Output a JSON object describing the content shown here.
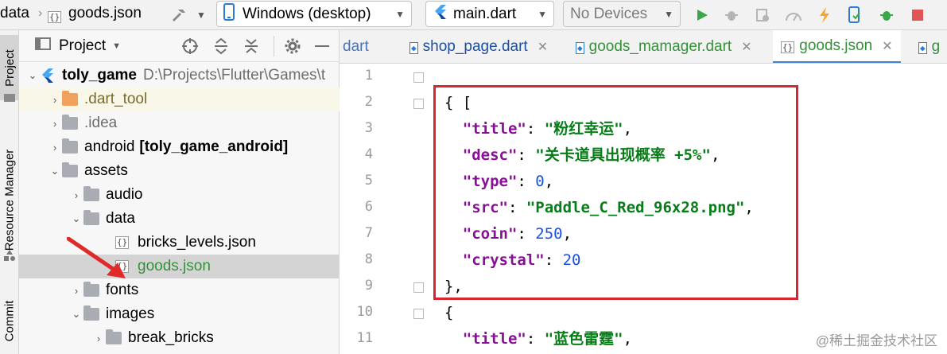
{
  "breadcrumb": [
    "data",
    "goods.json"
  ],
  "toolbar": {
    "device_target": "Windows (desktop)",
    "run_config": "main.dart",
    "devices": "No Devices"
  },
  "side_tabs": [
    "Project",
    "Resource Manager",
    "Commit"
  ],
  "panel": {
    "title": "Project"
  },
  "tree": [
    {
      "arrow": "⌄",
      "icon": "flutter",
      "label": "toly_game",
      "extra": "D:\\Projects\\Flutter\\Games\\t",
      "bold": true
    },
    {
      "arrow": "›",
      "icon": "folder-orange",
      "label": ".dart_tool"
    },
    {
      "arrow": "›",
      "icon": "idea",
      "label": ".idea"
    },
    {
      "arrow": "›",
      "icon": "folder-android",
      "label": "android",
      "extra": "[toly_game_android]"
    },
    {
      "arrow": "⌄",
      "icon": "folder",
      "label": "assets"
    },
    {
      "arrow": "›",
      "icon": "folder",
      "label": "audio"
    },
    {
      "arrow": "⌄",
      "icon": "folder",
      "label": "data"
    },
    {
      "arrow": "",
      "icon": "json",
      "label": "bricks_levels.json"
    },
    {
      "arrow": "",
      "icon": "json",
      "label": "goods.json",
      "selected": true
    },
    {
      "arrow": "›",
      "icon": "folder",
      "label": "fonts"
    },
    {
      "arrow": "⌄",
      "icon": "folder",
      "label": "images"
    },
    {
      "arrow": "›",
      "icon": "folder",
      "label": "break_bricks"
    }
  ],
  "tabs": [
    {
      "label": "dart",
      "icon": ""
    },
    {
      "label": "shop_page.dart",
      "icon": "dart"
    },
    {
      "label": "goods_mamager.dart",
      "icon": "dart"
    },
    {
      "label": "goods.json",
      "icon": "json",
      "active": true
    },
    {
      "label": "g",
      "icon": "dart"
    }
  ],
  "line_numbers": [
    "1",
    "2",
    "3",
    "4",
    "5",
    "6",
    "7",
    "8",
    "9",
    "10",
    "11"
  ],
  "code": [
    {
      "indent": "",
      "segs": [
        {
          "t": "[",
          "c": "p"
        }
      ]
    },
    {
      "indent": "  ",
      "segs": [
        {
          "t": "{",
          "c": "p"
        }
      ]
    },
    {
      "indent": "    ",
      "segs": [
        {
          "t": "\"title\"",
          "c": "k"
        },
        {
          "t": ": ",
          "c": "p"
        },
        {
          "t": "\"粉红幸运\"",
          "c": "s"
        },
        {
          "t": ",",
          "c": "p"
        }
      ]
    },
    {
      "indent": "    ",
      "segs": [
        {
          "t": "\"desc\"",
          "c": "k"
        },
        {
          "t": ": ",
          "c": "p"
        },
        {
          "t": "\"关卡道具出现概率 +5%\"",
          "c": "s"
        },
        {
          "t": ",",
          "c": "p"
        }
      ]
    },
    {
      "indent": "    ",
      "segs": [
        {
          "t": "\"type\"",
          "c": "k"
        },
        {
          "t": ": ",
          "c": "p"
        },
        {
          "t": "0",
          "c": "n"
        },
        {
          "t": ",",
          "c": "p"
        }
      ]
    },
    {
      "indent": "    ",
      "segs": [
        {
          "t": "\"src\"",
          "c": "k"
        },
        {
          "t": ": ",
          "c": "p"
        },
        {
          "t": "\"Paddle_C_Red_96x28.png\"",
          "c": "s"
        },
        {
          "t": ",",
          "c": "p"
        }
      ]
    },
    {
      "indent": "    ",
      "segs": [
        {
          "t": "\"coin\"",
          "c": "k"
        },
        {
          "t": ": ",
          "c": "p"
        },
        {
          "t": "250",
          "c": "n"
        },
        {
          "t": ",",
          "c": "p"
        }
      ]
    },
    {
      "indent": "    ",
      "segs": [
        {
          "t": "\"crystal\"",
          "c": "k"
        },
        {
          "t": ": ",
          "c": "p"
        },
        {
          "t": "20",
          "c": "n"
        }
      ]
    },
    {
      "indent": "  ",
      "segs": [
        {
          "t": "},",
          "c": "p"
        }
      ]
    },
    {
      "indent": "  ",
      "segs": [
        {
          "t": "{",
          "c": "p"
        }
      ]
    },
    {
      "indent": "    ",
      "segs": [
        {
          "t": "\"title\"",
          "c": "k"
        },
        {
          "t": ": ",
          "c": "p"
        },
        {
          "t": "\"蓝色雷霆\"",
          "c": "s"
        },
        {
          "t": ",",
          "c": "p"
        }
      ]
    }
  ],
  "watermark": "@稀土掘金技术社区",
  "colors": {
    "highlight_box": "#d6262f",
    "accent": "#4083c9"
  }
}
